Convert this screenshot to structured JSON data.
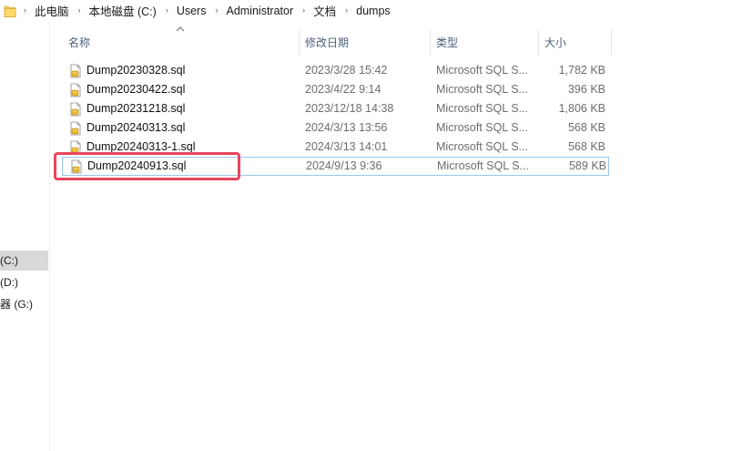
{
  "address_bar": {
    "crumbs": [
      "此电脑",
      "本地磁盘 (C:)",
      "Users",
      "Administrator",
      "文档",
      "dumps"
    ],
    "separator": "›"
  },
  "nav_pane": {
    "items": [
      {
        "label": "(C:)",
        "selected": true
      },
      {
        "label": "(D:)",
        "selected": false
      },
      {
        "label": "器 (G:)",
        "selected": false
      }
    ]
  },
  "columns": {
    "name": "名称",
    "date": "修改日期",
    "type": "类型",
    "size": "大小",
    "sort_indicator": "ascending"
  },
  "files": [
    {
      "name": "Dump20230328.sql",
      "date": "2023/3/28 15:42",
      "type": "Microsoft SQL S...",
      "size": "1,782 KB"
    },
    {
      "name": "Dump20230422.sql",
      "date": "2023/4/22 9:14",
      "type": "Microsoft SQL S...",
      "size": "396 KB"
    },
    {
      "name": "Dump20231218.sql",
      "date": "2023/12/18 14:38",
      "type": "Microsoft SQL S...",
      "size": "1,806 KB"
    },
    {
      "name": "Dump20240313.sql",
      "date": "2024/3/13 13:56",
      "type": "Microsoft SQL S...",
      "size": "568 KB"
    },
    {
      "name": "Dump20240313-1.sql",
      "date": "2024/3/13 14:01",
      "type": "Microsoft SQL S...",
      "size": "568 KB"
    },
    {
      "name": "Dump20240913.sql",
      "date": "2024/9/13 9:36",
      "type": "Microsoft SQL S...",
      "size": "589 KB"
    }
  ],
  "colors": {
    "highlight_border": "#e8465f",
    "selection_border": "#99c9ef",
    "header_text": "#4c607a",
    "nav_selected": "#d9d9d9"
  },
  "icons": {
    "breadcrumb_root": "folder-icon",
    "file": "sql-file-icon",
    "sort": "sort-up-icon"
  }
}
